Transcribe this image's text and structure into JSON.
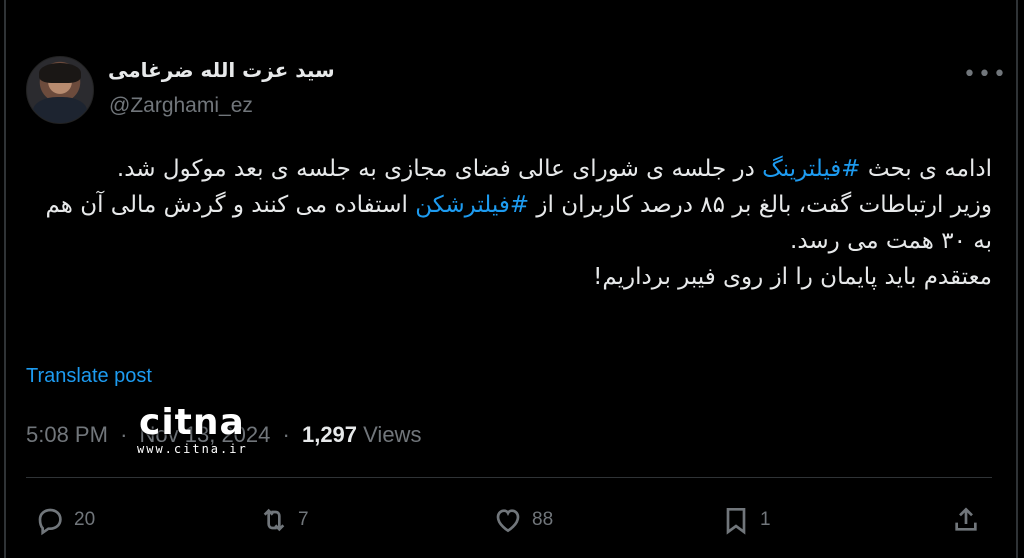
{
  "author": {
    "display_name": "سید عزت الله ضرغامی",
    "handle": "@Zarghami_ez"
  },
  "tweet": {
    "line1_pre": "ادامه ی بحث ",
    "hashtag1": "#فیلترینگ",
    "line1_post": " در جلسه ی شورای عالی فضای مجازی به جلسه ی بعد موکول شد.",
    "line2_pre": "وزیر ارتباطات گفت، بالغ بر ۸۵ درصد کاربران از ",
    "hashtag2": "#فیلترشکن",
    "line2_post": " استفاده می کنند و گردش مالی آن هم به ۳۰ همت می رسد.",
    "line3": "معتقدم باید پایمان را از روی فیبر برداریم!"
  },
  "translate_label": "Translate post",
  "meta": {
    "time": "5:08 PM",
    "date": "Nov 13, 2024",
    "views_count": "1,297",
    "views_label": "Views",
    "separator": "·"
  },
  "watermark": {
    "logo": "citna",
    "url": "www.citna.ir"
  },
  "actions": {
    "reply_count": "20",
    "retweet_count": "7",
    "like_count": "88",
    "bookmark_count": "1"
  },
  "icons": [
    "more-icon",
    "reply-icon",
    "retweet-icon",
    "like-icon",
    "bookmark-icon",
    "share-icon"
  ],
  "colors": {
    "background": "#000000",
    "text": "#e7e9ea",
    "secondary": "#71767b",
    "accent": "#1d9bf0",
    "divider": "#2f3336"
  }
}
